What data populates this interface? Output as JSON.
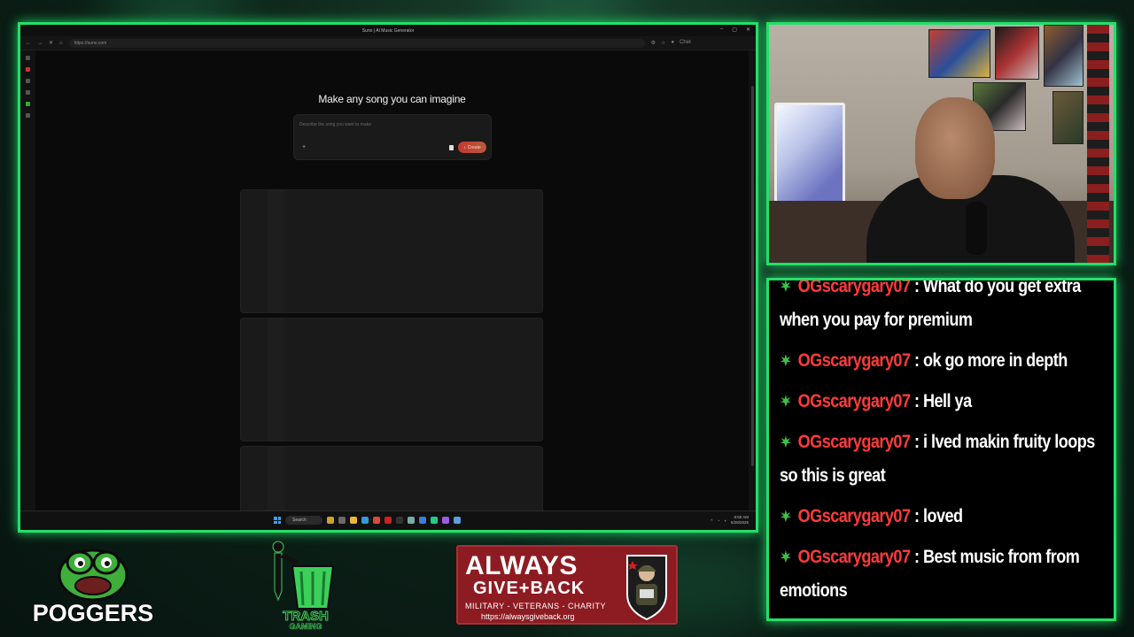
{
  "browser": {
    "window_title": "Suno | AI Music Generator",
    "url": "https://suno.com",
    "profile": "Chet"
  },
  "suno": {
    "headline": "Make any song you can imagine",
    "prompt_placeholder": "Describe the song you want to make",
    "create_label": "Create"
  },
  "taskbar": {
    "search_label": "Search",
    "time": "8:50 AM",
    "date": "5/28/2025"
  },
  "chat": {
    "messages": [
      {
        "user": "OGscarygary07",
        "text": " : What do you get extra when you pay for premium"
      },
      {
        "user": "OGscarygary07",
        "text": " : ok go more in depth"
      },
      {
        "user": "OGscarygary07",
        "text": " : Hell ya"
      },
      {
        "user": "OGscarygary07",
        "text": " : i lved makin fruity loops so this is great"
      },
      {
        "user": "OGscarygary07",
        "text": " : loved"
      },
      {
        "user": "OGscarygary07",
        "text": " : Best music from from emotions"
      }
    ]
  },
  "logos": {
    "poggers": "POGGERS",
    "trash_top": "TRASH",
    "trash_bottom": "GAMING",
    "agb_title": "ALWAYS",
    "agb_sub": "GIVE+BACK",
    "agb_tagline": "MILITARY - VETERANS - CHARITY",
    "agb_url": "https://alwaysgiveback.org"
  },
  "colors": {
    "frame_green": "#22e06a",
    "chat_username": "#ff3b3b",
    "suno_create": "#c4382f",
    "agb_red": "#8d1c22"
  },
  "icons": [
    "leaf-icon",
    "search-icon",
    "windows-start-icon",
    "plus-icon",
    "create-icon",
    "shield-icon"
  ]
}
